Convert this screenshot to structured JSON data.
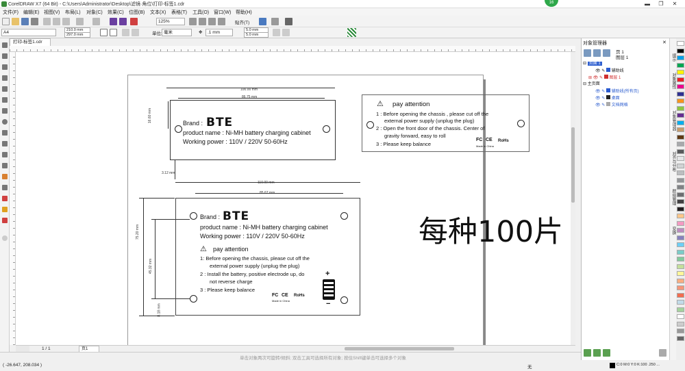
{
  "window": {
    "app_title": "CorelDRAW X7 (64 Bit) - C:\\Users\\Administrator\\Desktop\\滤镜·角位\\打印-标签1.cdr",
    "badge": "16"
  },
  "menu": [
    "文件(F)",
    "编辑(E)",
    "视图(V)",
    "布局(L)",
    "对象(C)",
    "效果(C)",
    "位图(B)",
    "文本(X)",
    "表格(T)",
    "工具(O)",
    "窗口(W)",
    "帮助(H)"
  ],
  "toolbar1": {
    "zoom": "125%",
    "snap": "贴齐(T)"
  },
  "toolbar2": {
    "page_size": "A4",
    "width": "210.0 mm",
    "height": "297.0 mm",
    "units_label": "单位:",
    "units": "毫米",
    "nudge": ".1 mm",
    "dup_x": "5.0 mm",
    "dup_y": "5.0 mm"
  },
  "doc_tab": "打印-标签1.cdr",
  "canvas": {
    "big_text": "每种100片",
    "spacing_label": "3.12 mm",
    "label1": {
      "dim_top": "100.00 mm",
      "dim_inner": "86.75 mm",
      "dim_side": "16.60 mm",
      "brand": "Brand :",
      "logo": "BTE",
      "product": "product name :  Ni-MH battery charging cabinet",
      "power": "Working power :  110V / 220V          50-60Hz"
    },
    "label2": {
      "title": "pay attention",
      "line1": "1 : Before opening  the chassis , please cut off the",
      "line1b": "external power supply (unplug the plug)",
      "line2": "2 : Open the front door of the chassis. Center of",
      "line2b": "gravity forward, easy to roll",
      "line3": "3 : Please keep balance",
      "fc": "FC",
      "ce": "CE",
      "rohs": "RoHs",
      "made": "Made in China"
    },
    "label3": {
      "dim_top": "110.00 mm",
      "dim_inner": "85.67 mm",
      "dim_left": "75.20 mm",
      "dim_left2": "45.32 mm",
      "dim_bottom": "8.18 mm",
      "brand": "Brand :",
      "logo": "BTE",
      "product": "product name :  Ni-MH battery charging cabinet",
      "power": "Working power :  110V / 220V          50-60Hz",
      "attention": "pay attention",
      "line1": "1:   Before opening the chassis, please cut off the",
      "line1b": "external power supply (unplug the plug)",
      "line2": "2 : Install the battery, positive electrode up, do",
      "line2b": "not reverse charge",
      "line3": "3 : Please keep balance",
      "fc": "FC",
      "ce": "CE",
      "rohs": "RoHs",
      "made": "Made in China",
      "plus": "+",
      "minus": "−"
    }
  },
  "page_nav": {
    "counter": "1 / 1",
    "page_tab": "页1"
  },
  "status": {
    "coords": "( -26.647, 208.034 )",
    "hint": "单击对象两次可旋转/倾斜; 双击工具可选择所有对象; 按住Shift键单击可选择多个对象",
    "fill_info": "C:0 M:0 Y:0 K:100  .250 ...",
    "outline": "无"
  },
  "object_manager": {
    "title": "对象管理器",
    "page_label": "页 1",
    "layer_label": "图层 1",
    "rows": [
      "页面 1",
      "辅助线",
      "图层 1",
      "主页面",
      "辅助线(所有页)",
      "桌面",
      "文档网格"
    ]
  },
  "dock_tabs": [
    "提示",
    "对象属性",
    "对象管理器",
    "对齐与分布",
    "群组管理",
    "变换"
  ],
  "palette_colors": [
    "#ffffff",
    "#000000",
    "#00a0e9",
    "#00a651",
    "#fff200",
    "#ed1c24",
    "#ec008c",
    "#2e3192",
    "#f7941d",
    "#8dc63f",
    "#662d91",
    "#00aeef",
    "#c69c6d",
    "#603913",
    "#a7a9ac",
    "#58595b",
    "#e6e7e8",
    "#d1d3d4",
    "#bcbec0",
    "#939598",
    "#808285",
    "#6d6e71",
    "#414042",
    "#231f20",
    "#fdc689",
    "#f49ac2",
    "#bd8cbf",
    "#8781bd",
    "#6dcff6",
    "#7accc8",
    "#82ca9c",
    "#c4df9b",
    "#fff799",
    "#f9ad81",
    "#f69679",
    "#f26c4f",
    "#c2dbe9",
    "#a3d39c",
    "#ffffff",
    "#cccccc",
    "#999999",
    "#666666"
  ]
}
